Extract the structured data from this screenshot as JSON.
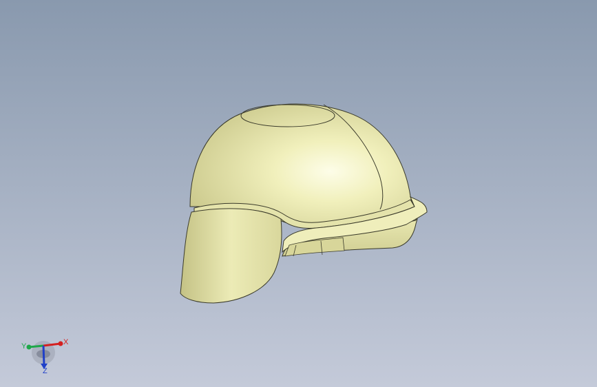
{
  "viewport": {
    "background_top": "#8a9bb0",
    "background_bottom": "#c3c9d8",
    "model_color": "#f2f1bd",
    "edge_color": "#3a3a2a"
  },
  "model": {
    "name": "helmet"
  },
  "triad": {
    "x_label": "X",
    "y_label": "Y",
    "z_label": "Z",
    "x_color": "#d42020",
    "y_color": "#1ea84a",
    "z_color": "#2040c8"
  }
}
